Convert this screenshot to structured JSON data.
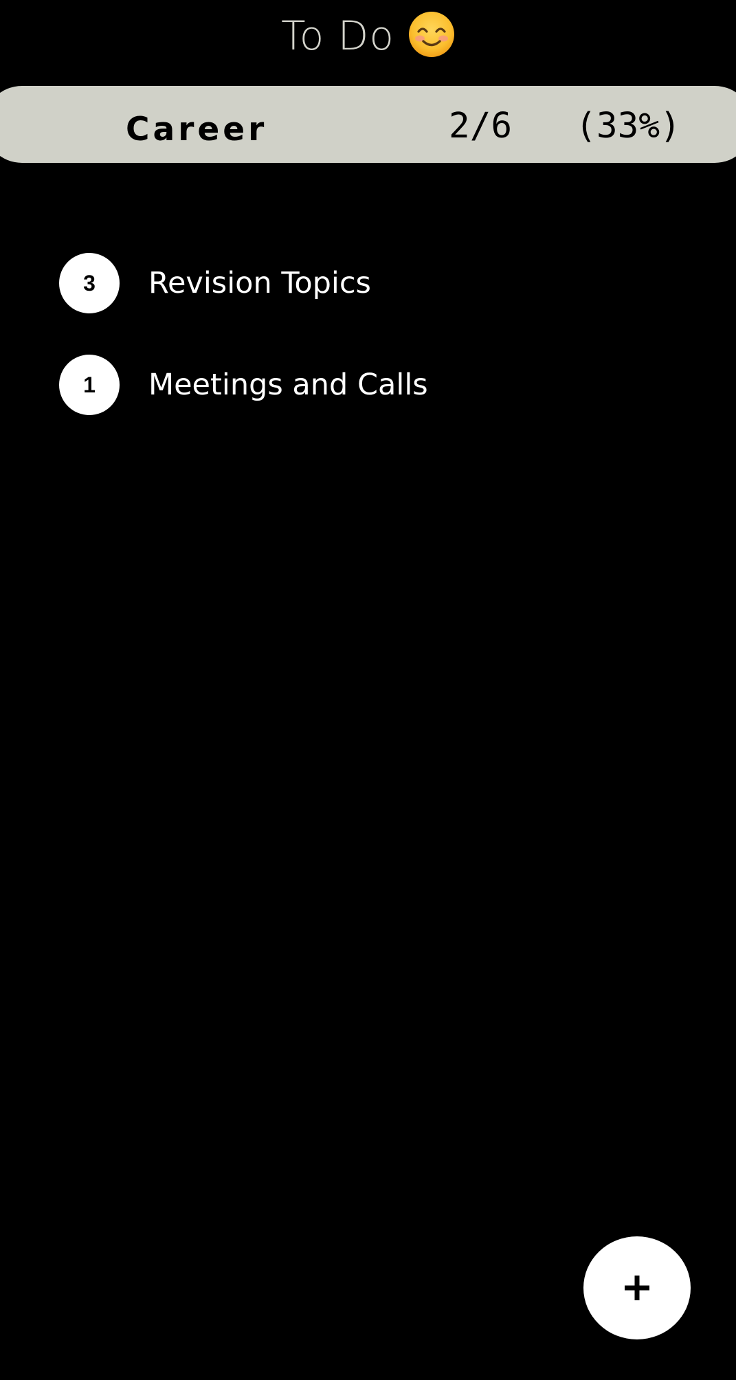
{
  "header": {
    "title": "To Do",
    "emoji_icon": "smiling-face-with-smiling-eyes-icon"
  },
  "category": {
    "name": "Career",
    "completed": 2,
    "total": 6,
    "progress_text": "2/6   (33%)"
  },
  "lists": [
    {
      "count": "3",
      "label": "Revision Topics"
    },
    {
      "count": "1",
      "label": "Meetings and Calls"
    }
  ],
  "fab": {
    "icon": "plus-icon"
  },
  "colors": {
    "background": "#000000",
    "category_bar": "#d0d1c8",
    "title_text": "#d4d4cc",
    "item_text": "#ffffff",
    "badge": "#ffffff"
  }
}
